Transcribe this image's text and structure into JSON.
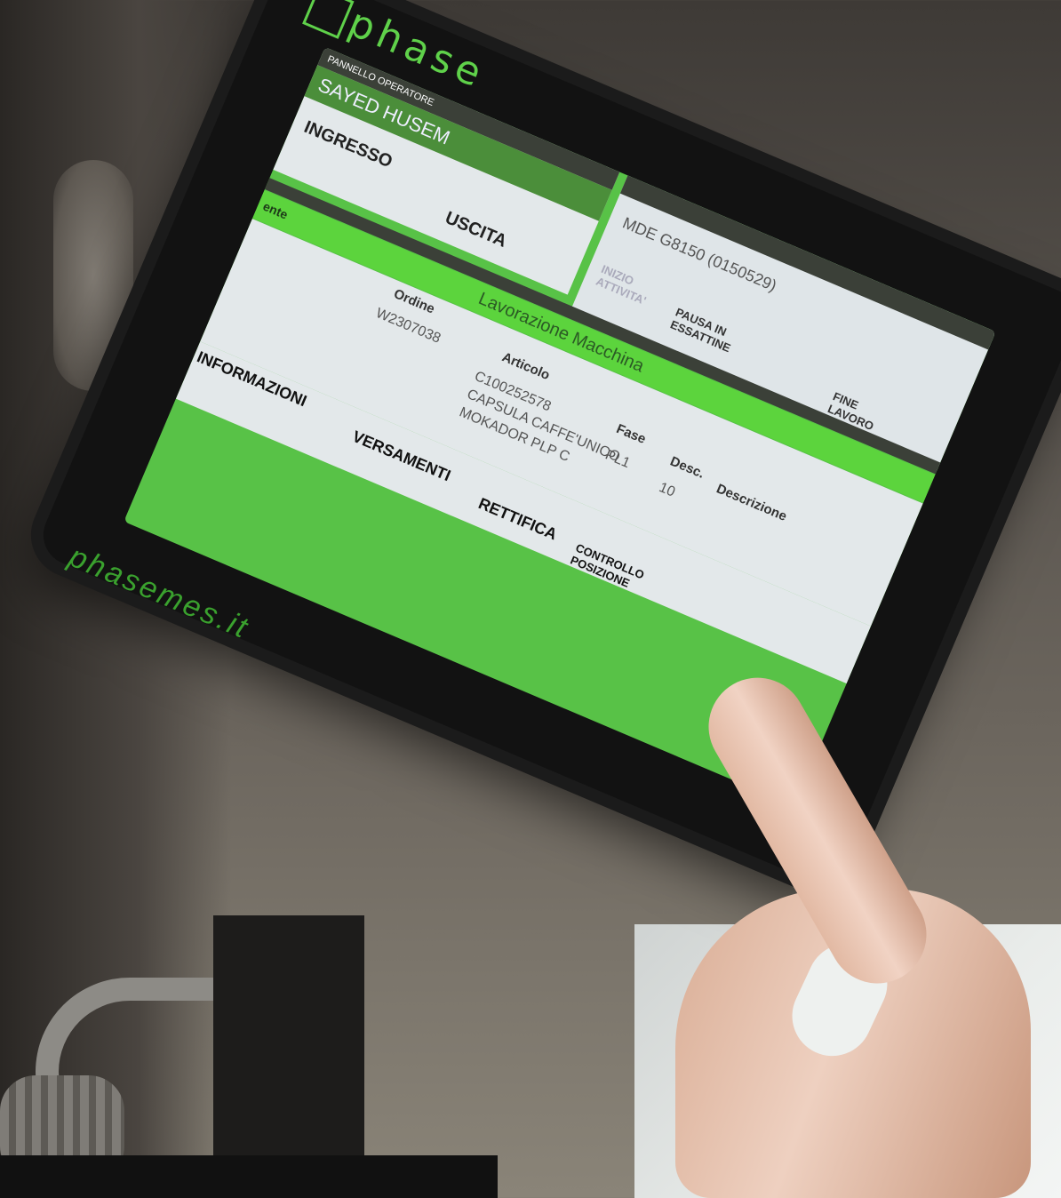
{
  "monitor": {
    "brand": "phase",
    "url": "phasemes.it"
  },
  "operator_panel": {
    "header": "PANNELLO OPERATORE",
    "operator_name": "SAYED HUSEM",
    "checkin_label": "INGRESSO",
    "checkout_label": "USCITA"
  },
  "machine_panel": {
    "code": "MDE G8150 (0150529)",
    "start_label": "INIZIO ATTIVITA'",
    "pause_label": "PAUSA IN ESSATTINE",
    "btn3_label": "",
    "finish_label": "FINE LAVORO"
  },
  "status_bar": {
    "title": "Lavorazione Macchina",
    "left_label": "ente"
  },
  "order_table": {
    "headers": [
      "Ordine",
      "Articolo",
      "Fase",
      "Desc.",
      "Descrizione"
    ],
    "order": "W2307038",
    "article_code": "C100252578",
    "article_desc_1": "CAPSULA CAFFE'UNICO",
    "article_desc_2": "MOKADOR PLP C",
    "phase": "PL1",
    "step": "10"
  },
  "menu": {
    "info": "INFORMAZIONI",
    "payments": "VERSAMENTI",
    "correction": "RETTIFICA",
    "check_positioning": "CONTROLLO POSIZIONE"
  },
  "colors": {
    "screen_green": "#58c247",
    "header_dark": "#3b4038",
    "operator_green": "#4b8e3a"
  }
}
